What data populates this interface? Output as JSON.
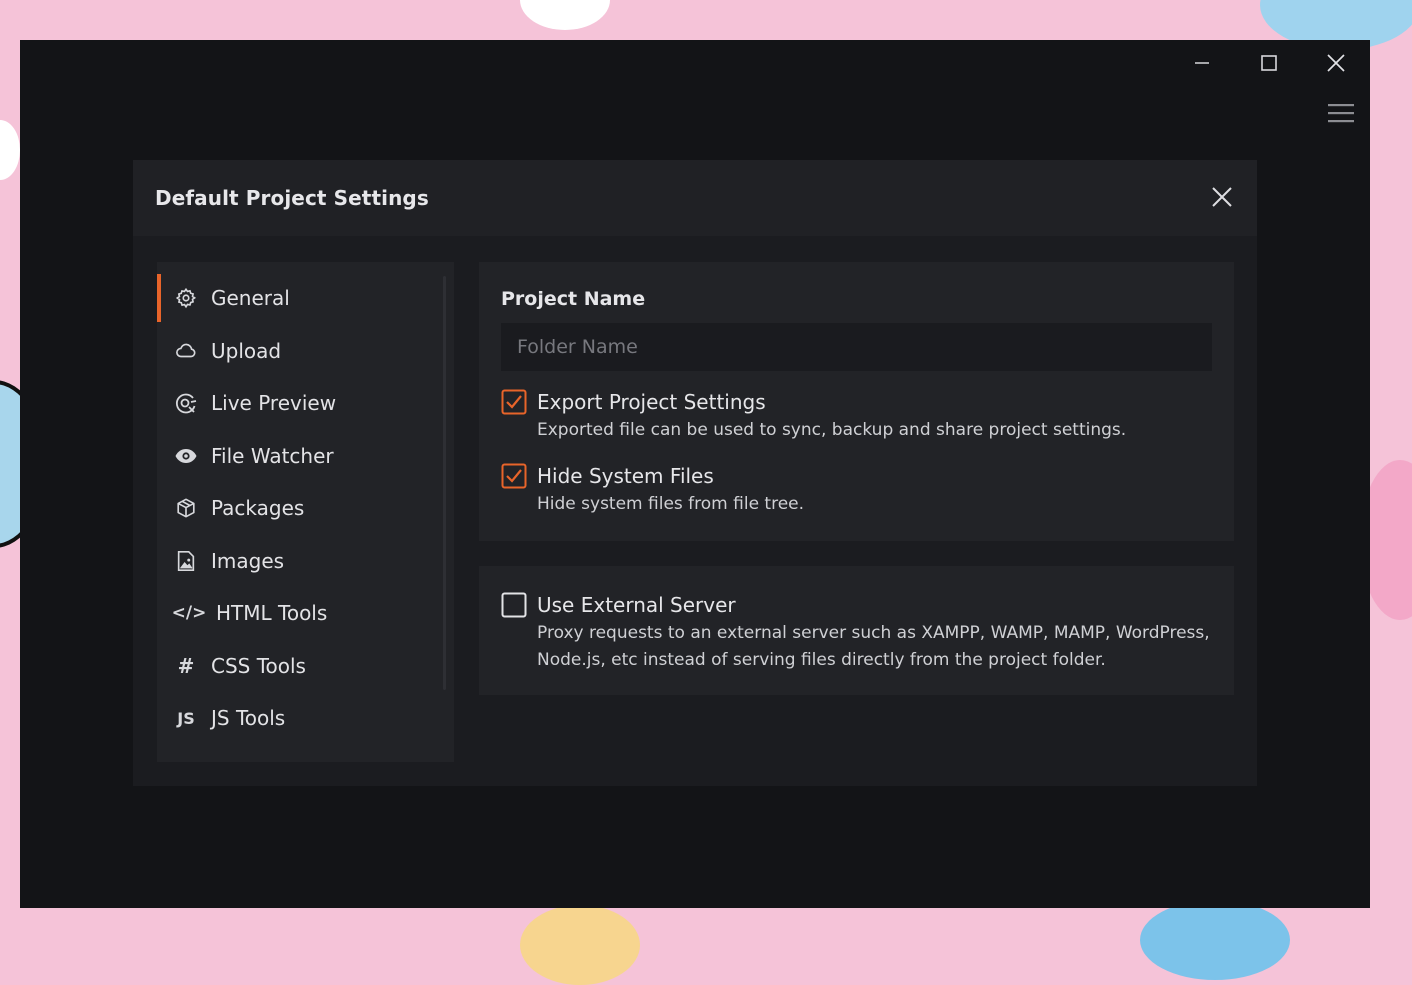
{
  "window": {
    "controls": [
      "minimize",
      "maximize",
      "close"
    ],
    "menu_icon": "hamburger-menu-icon"
  },
  "dialog": {
    "title": "Default Project Settings",
    "close_icon": "close-icon"
  },
  "sidebar": {
    "active_index": 0,
    "accent_color": "#e8642a",
    "items": [
      {
        "label": "General",
        "icon": "gear-icon"
      },
      {
        "label": "Upload",
        "icon": "cloud-icon"
      },
      {
        "label": "Live Preview",
        "icon": "live-preview-icon"
      },
      {
        "label": "File Watcher",
        "icon": "eye-icon"
      },
      {
        "label": "Packages",
        "icon": "package-icon"
      },
      {
        "label": "Images",
        "icon": "image-icon"
      },
      {
        "label": "HTML Tools",
        "icon": "code-icon",
        "glyph": "</>"
      },
      {
        "label": "CSS Tools",
        "icon": "hash-icon",
        "glyph": "#"
      },
      {
        "label": "JS Tools",
        "icon": "js-icon",
        "glyph": "JS"
      }
    ]
  },
  "general": {
    "project_name": {
      "label": "Project Name",
      "value": "",
      "placeholder": "Folder Name"
    },
    "options": [
      {
        "title": "Export Project Settings",
        "description": "Exported file can be used to sync, backup and share project settings.",
        "checked": true
      },
      {
        "title": "Hide System Files",
        "description": "Hide system files from file tree.",
        "checked": true
      }
    ],
    "external_server": {
      "title": "Use External Server",
      "description_line1": "Proxy requests to an external server such as XAMPP, WAMP, MAMP, WordPress,",
      "description_line2": "Node.js, etc instead of serving files directly from the project folder.",
      "checked": false
    }
  }
}
